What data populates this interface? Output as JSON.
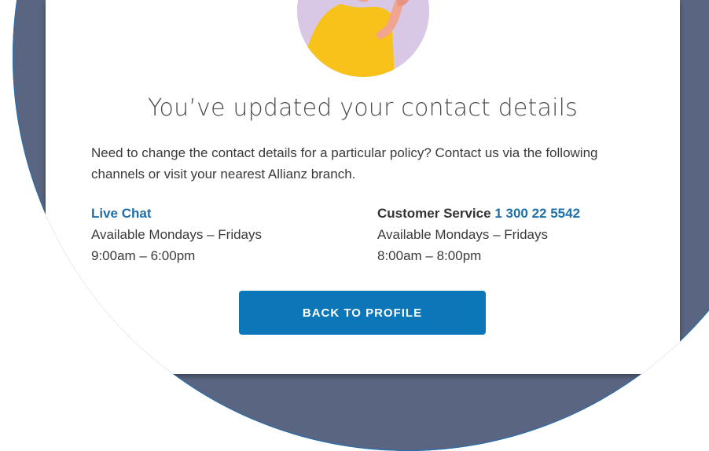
{
  "confirmation": {
    "title": "You’ve updated your contact details",
    "description": "Need to change the contact details for a particular policy? Contact us via the following channels or visit your nearest Allianz branch.",
    "live_chat": {
      "label": "Live Chat",
      "availability": "Available Mondays – Fridays",
      "hours": "9:00am – 6:00pm"
    },
    "customer_service": {
      "label": "Customer Service",
      "phone": "1 300 22 5542",
      "availability": "Available Mondays – Fridays",
      "hours": "8:00am – 8:00pm"
    },
    "back_button_label": "BACK TO PROFILE"
  },
  "colors": {
    "accent": "#0b76b8",
    "link": "#1d6fa8",
    "background_overlay": "#5a6581",
    "avatar_bg": "#d8c8e6",
    "shirt": "#f7c21a",
    "skin": "#f1a48f"
  },
  "icons": {
    "avatar": "person-thumbs-up-illustration"
  }
}
